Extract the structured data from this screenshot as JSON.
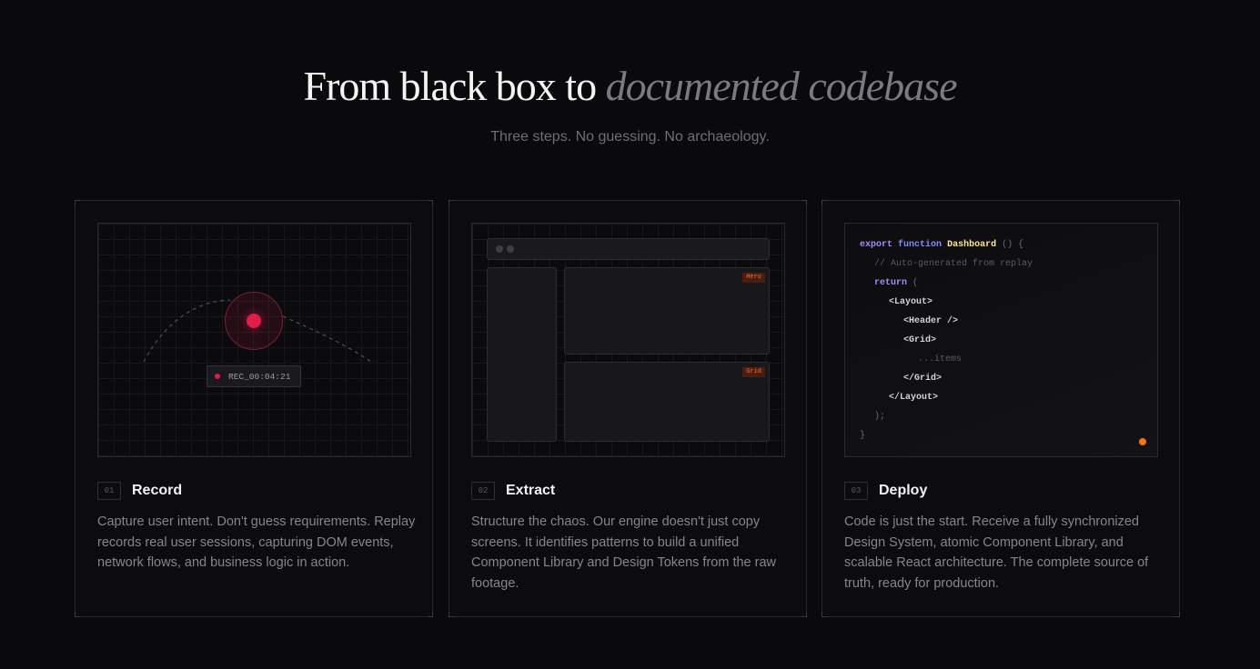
{
  "hero": {
    "title_main": "From black box to ",
    "title_accent": "documented codebase",
    "subtitle": "Three steps. No guessing. No archaeology."
  },
  "steps": [
    {
      "number": "01",
      "title": "Record",
      "description": "Capture user intent. Don't guess requirements. Replay records real user sessions, capturing DOM events, network flows, and business logic in action.",
      "visual": {
        "recording_label": "REC_00:04:21",
        "accent_color": "#e11d48"
      }
    },
    {
      "number": "02",
      "title": "Extract",
      "description": "Structure the chaos. Our engine doesn't just copy screens. It identifies patterns to build a unified Component Library and Design Tokens from the raw footage.",
      "visual": {
        "tags": [
          "Hero",
          "Grid"
        ],
        "accent_color": "#f97316"
      }
    },
    {
      "number": "03",
      "title": "Deploy",
      "description": "Code is just the start. Receive a fully synchronized Design System, atomic Component Library, and scalable React architecture. The complete source of truth, ready for production.",
      "visual": {
        "code": {
          "kw_export": "export",
          "kw_function": "function",
          "fn_name": "Dashboard",
          "parens": "() {",
          "comment": "// Auto-generated from replay",
          "kw_return": "return",
          "open_paren": "(",
          "layout_open": "<Layout>",
          "header": "<Header />",
          "grid_open": "<Grid>",
          "items": "...items",
          "grid_close": "</Grid>",
          "layout_close": "</Layout>",
          "close_paren": ");",
          "close_brace": "}"
        }
      }
    }
  ]
}
